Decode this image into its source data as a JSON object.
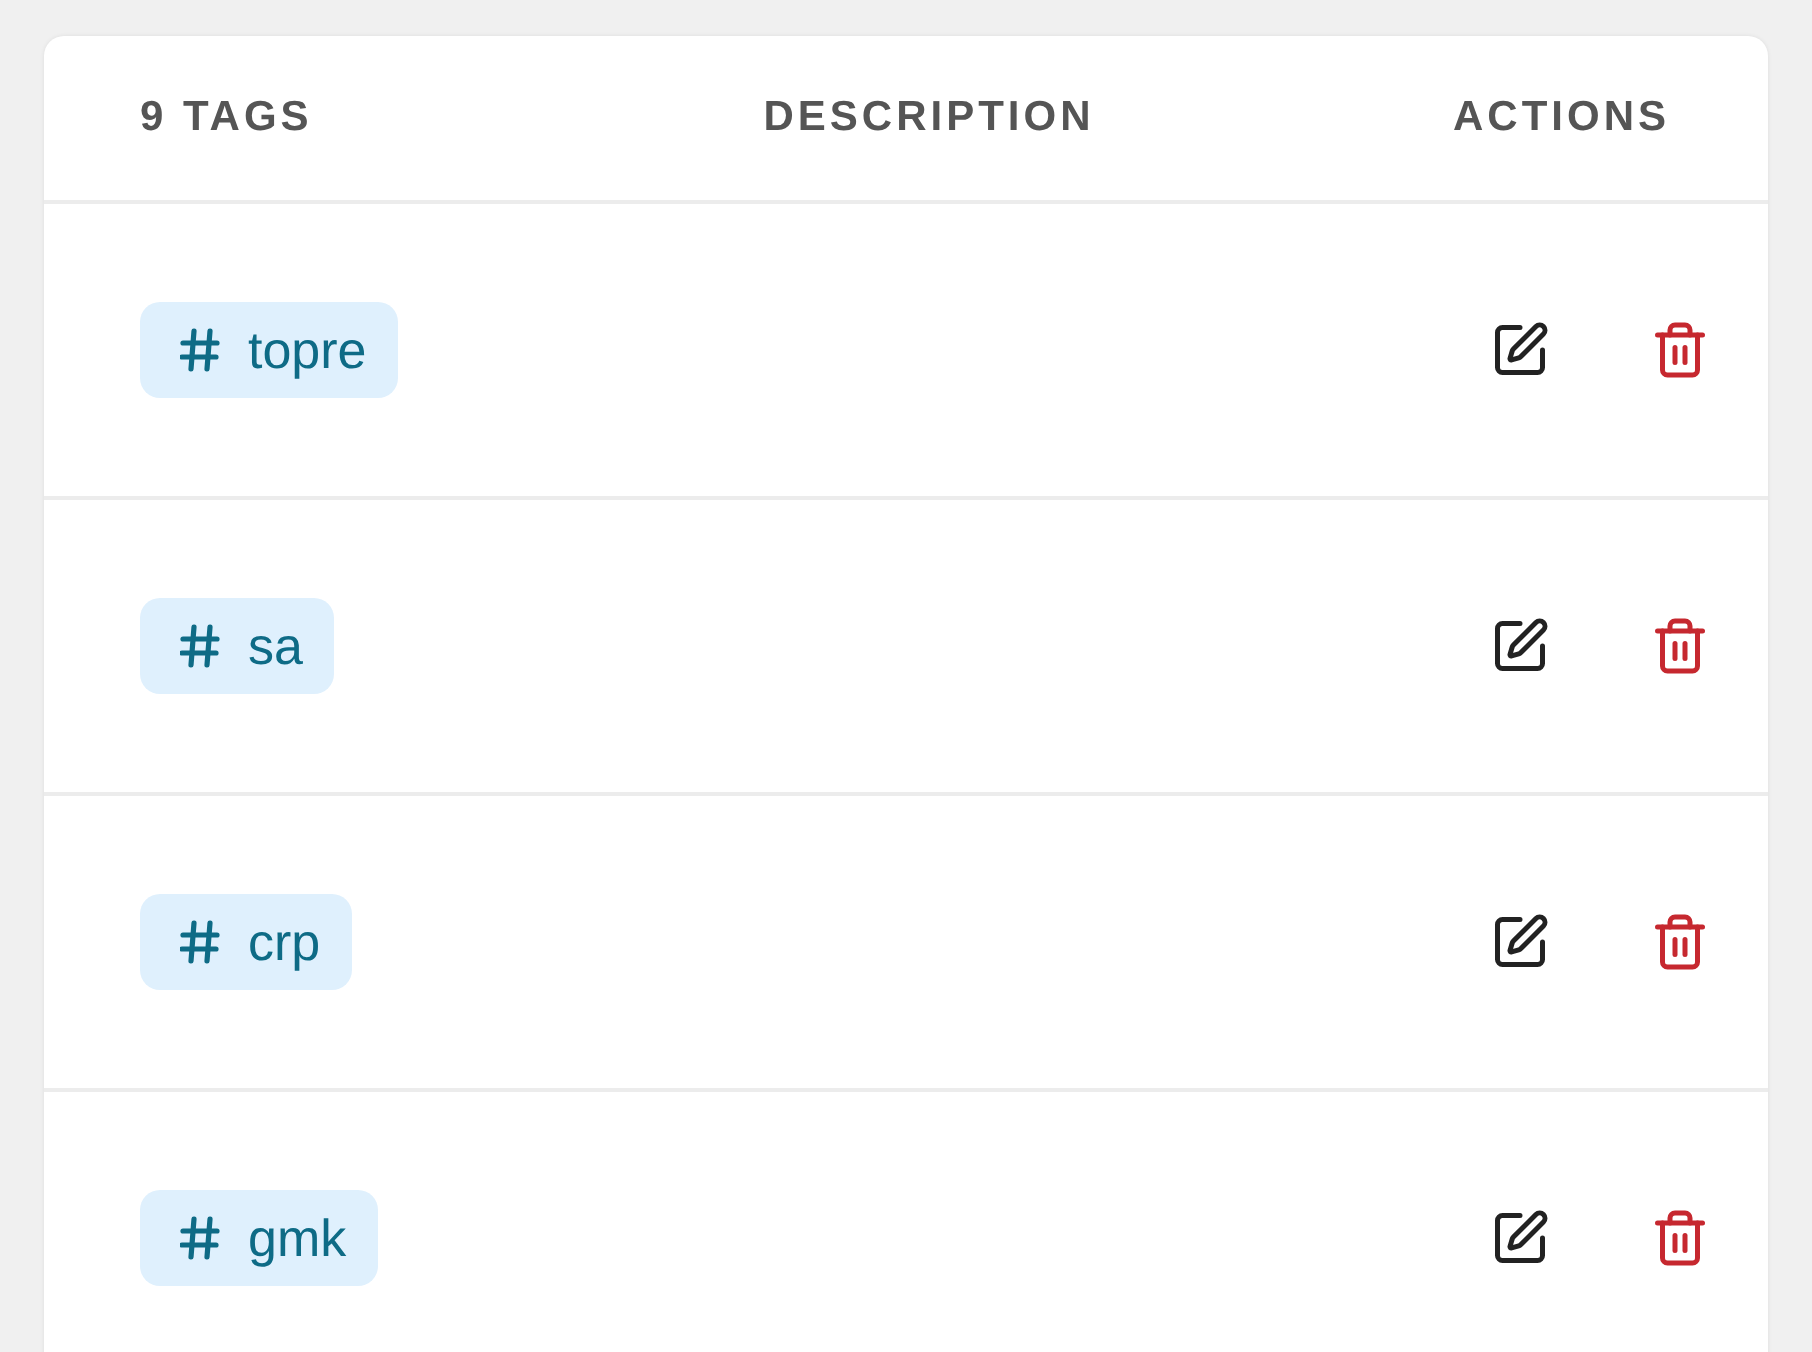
{
  "table": {
    "columns": [
      {
        "label": "9 TAGS"
      },
      {
        "label": "DESCRIPTION"
      },
      {
        "label": "ACTIONS"
      }
    ],
    "rows": [
      {
        "tag": "topre"
      },
      {
        "tag": "sa"
      },
      {
        "tag": "crp"
      },
      {
        "tag": "gmk"
      }
    ]
  }
}
